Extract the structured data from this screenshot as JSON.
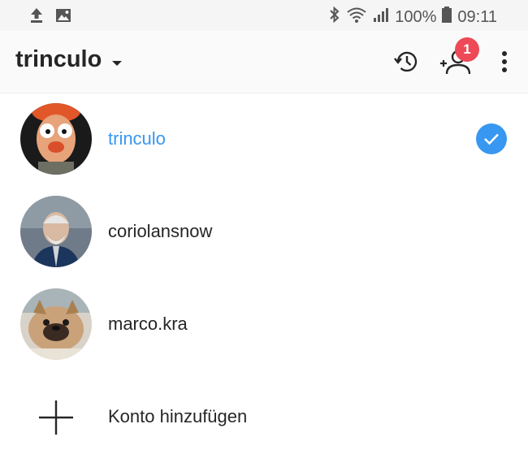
{
  "status_bar": {
    "icons_left": [
      "upload-icon",
      "image-icon"
    ],
    "icons_right": [
      "bluetooth-icon",
      "wifi-icon",
      "signal-icon",
      "battery-icon"
    ],
    "battery_percent": "100%",
    "time": "09:11"
  },
  "header": {
    "account_name": "trinculo",
    "notification_count": "1",
    "icons": [
      "history-icon",
      "add-person-icon",
      "more-vert-icon"
    ]
  },
  "accounts": [
    {
      "username": "trinculo",
      "active": true
    },
    {
      "username": "coriolansnow",
      "active": false
    },
    {
      "username": "marco.kra",
      "active": false
    }
  ],
  "add_account_label": "Konto hinzufügen",
  "colors": {
    "accent_blue": "#3897f0",
    "badge_red": "#ed4956",
    "text_dark": "#262626"
  }
}
